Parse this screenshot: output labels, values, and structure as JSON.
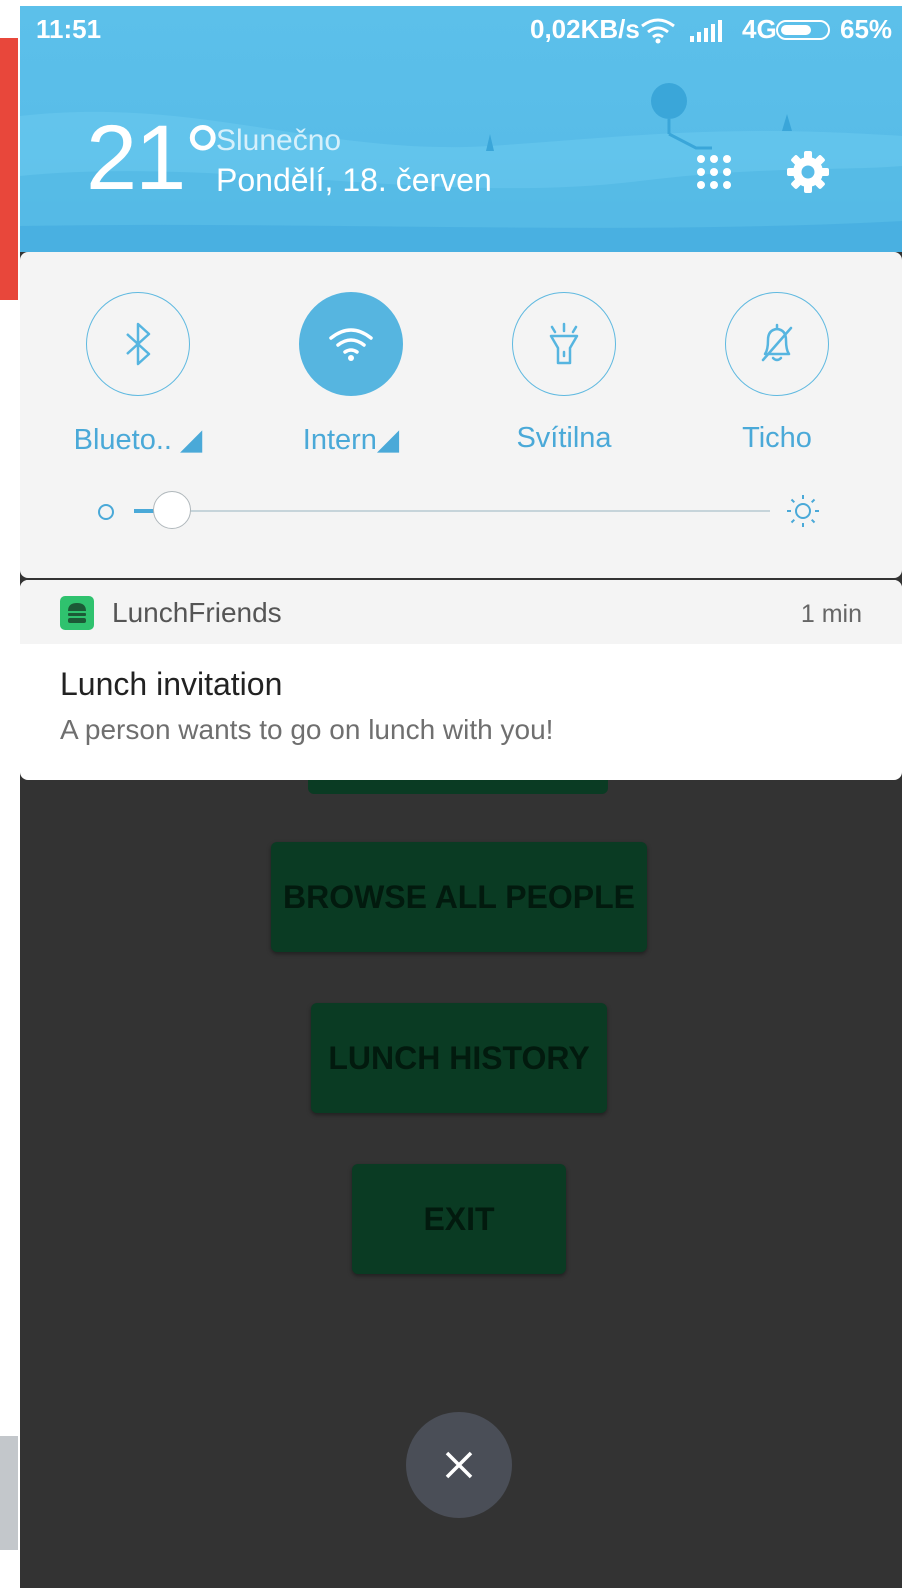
{
  "status_bar": {
    "time": "11:51",
    "speed": "0,02KB/s",
    "network": "4G",
    "battery": "65%"
  },
  "weather": {
    "temperature": "21°",
    "condition": "Slunečno",
    "date": "Pondělí, 18. červen"
  },
  "quick_settings": {
    "toggles": [
      {
        "label": "Blueto.. ◢",
        "icon": "bluetooth-icon",
        "active": false
      },
      {
        "label": "Intern◢",
        "icon": "wifi-icon",
        "active": true
      },
      {
        "label": "Svítilna",
        "icon": "flashlight-icon",
        "active": false
      },
      {
        "label": "Ticho",
        "icon": "bell-off-icon",
        "active": false
      }
    ],
    "brightness_level": 0.06
  },
  "notification": {
    "app_name": "LunchFriends",
    "time": "1 min",
    "title": "Lunch invitation",
    "body": "A person wants to go on lunch with you!"
  },
  "app_buttons": {
    "browse": "BROWSE ALL PEOPLE",
    "history": "LUNCH HISTORY",
    "exit": "EXIT"
  },
  "colors": {
    "accent": "#56b5e0",
    "app_green": "#2fc26e",
    "button_dim": "#0a3b23"
  }
}
